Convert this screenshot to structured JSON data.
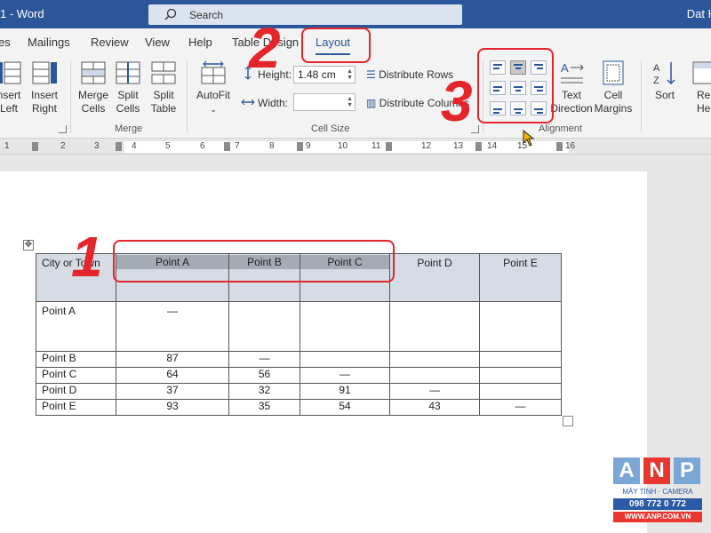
{
  "titlebar": {
    "title": "1  -  Word",
    "search_placeholder": "Search",
    "user": "Dat H"
  },
  "tabs": [
    {
      "label": "es"
    },
    {
      "label": "Mailings"
    },
    {
      "label": "Review"
    },
    {
      "label": "View"
    },
    {
      "label": "Help"
    },
    {
      "label": "Table Design"
    },
    {
      "label": "Layout"
    }
  ],
  "ribbon": {
    "insert_left": "nsert\nLeft",
    "insert_right": "Insert\nRight",
    "merge_cells": "Merge\nCells",
    "split_cells": "Split\nCells",
    "split_table": "Split\nTable",
    "merge_group": "Merge",
    "autofit": "AutoFit",
    "height_label": "Height:",
    "height_value": "1.48 cm",
    "width_label": "Width:",
    "width_value": "",
    "distribute_rows": "Distribute Rows",
    "distribute_columns": "Distribute Columns",
    "cell_size_group": "Cell Size",
    "text_direction": "Text\nDirection",
    "cell_margins": "Cell\nMargins",
    "alignment_group": "Alignment",
    "sort": "Sort",
    "repeat_header": "Re\nHeade"
  },
  "ruler": {
    "numbers": [
      "1",
      "2",
      "3",
      "4",
      "5",
      "6",
      "7",
      "8",
      "9",
      "10",
      "11",
      "12",
      "13",
      "14",
      "15",
      "16"
    ]
  },
  "table": {
    "header": [
      "City or Town",
      "Point A",
      "Point B",
      "Point C",
      "Point D",
      "Point E"
    ],
    "rows": [
      [
        "Point A",
        "—",
        "",
        "",
        "",
        ""
      ],
      [
        "Point B",
        "87",
        "—",
        "",
        "",
        ""
      ],
      [
        "Point C",
        "64",
        "56",
        "—",
        "",
        ""
      ],
      [
        "Point D",
        "37",
        "32",
        "91",
        "—",
        ""
      ],
      [
        "Point E",
        "93",
        "35",
        "54",
        "43",
        "—"
      ]
    ]
  },
  "annotations": {
    "step1": "1",
    "step2": "2",
    "step3": "3",
    "color": "#e4252b"
  },
  "logo": {
    "a": "A",
    "n": "N",
    "p": "P",
    "tagline": "MÁY TÍNH · CAMERA",
    "phone": "098 772 0 772",
    "web": "WWW.ANP.COM.VN"
  },
  "colors": {
    "accent": "#2b579a",
    "titlebar": "#2b579a"
  }
}
